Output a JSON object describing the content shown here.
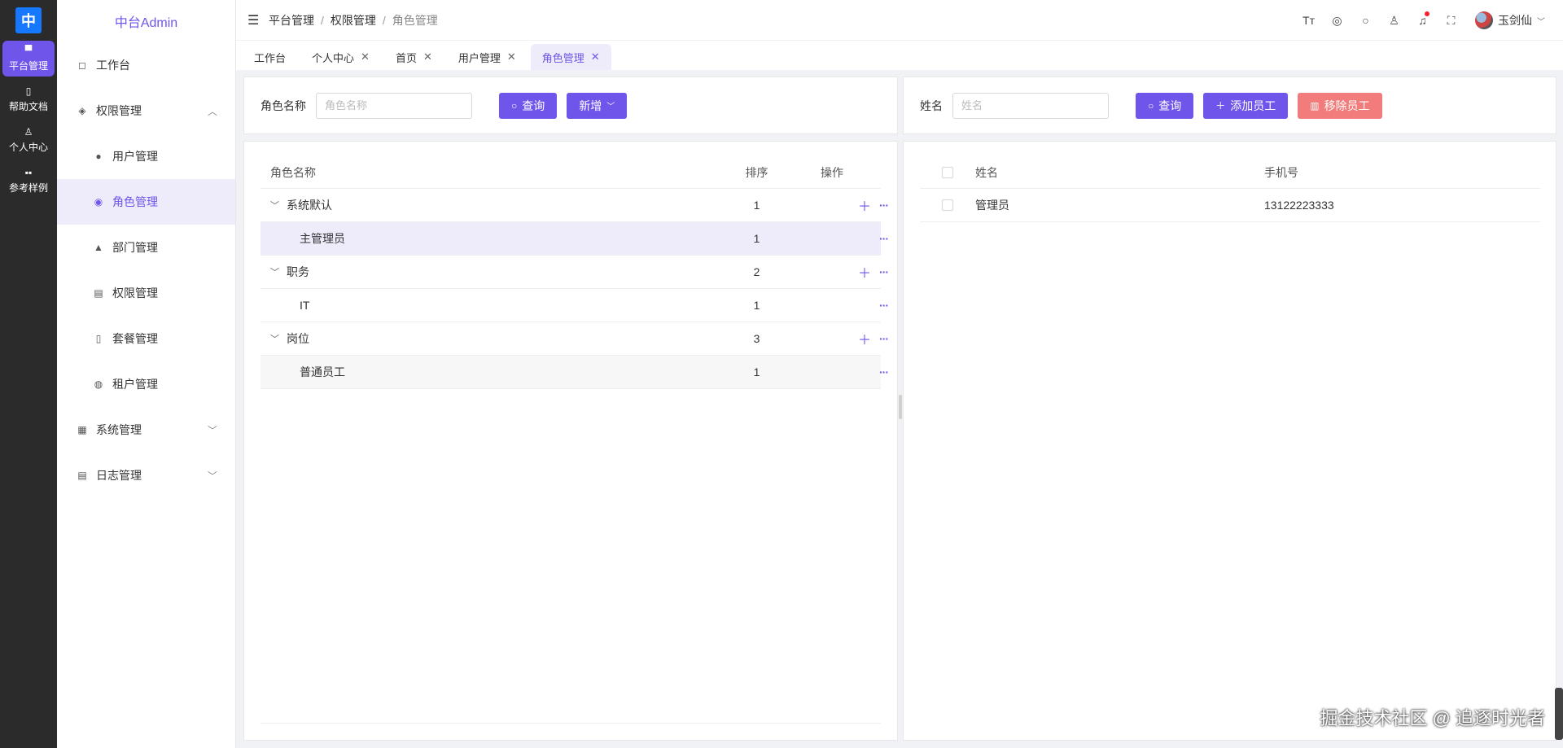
{
  "rail": {
    "logo": "中",
    "items": [
      {
        "label": "平台管理",
        "icon": "monitor-icon",
        "glyph": "▀"
      },
      {
        "label": "帮助文档",
        "icon": "document-icon",
        "glyph": "▯"
      },
      {
        "label": "个人中心",
        "icon": "user-icon",
        "glyph": "♙"
      },
      {
        "label": "参考样例",
        "icon": "grid-icon",
        "glyph": "▪▪"
      }
    ]
  },
  "menu": {
    "brand": "中台Admin",
    "items": [
      {
        "label": "工作台",
        "glyph": "◻"
      },
      {
        "label": "权限管理",
        "glyph": "◈"
      },
      {
        "label": "用户管理",
        "glyph": "●"
      },
      {
        "label": "角色管理",
        "glyph": "◉"
      },
      {
        "label": "部门管理",
        "glyph": "▲"
      },
      {
        "label": "权限管理",
        "glyph": "▤"
      },
      {
        "label": "套餐管理",
        "glyph": "▯"
      },
      {
        "label": "租户管理",
        "glyph": "◍"
      },
      {
        "label": "系统管理",
        "glyph": "▦"
      },
      {
        "label": "日志管理",
        "glyph": "▤"
      }
    ]
  },
  "header": {
    "breadcrumb": [
      "平台管理",
      "权限管理",
      "角色管理"
    ],
    "username": "玉剑仙"
  },
  "tabs": [
    "工作台",
    "个人中心",
    "首页",
    "用户管理",
    "角色管理"
  ],
  "role_search": {
    "label": "角色名称",
    "placeholder": "角色名称",
    "query_button": "查询",
    "add_button": "新增"
  },
  "user_search": {
    "label": "姓名",
    "placeholder": "姓名",
    "query_button": "查询",
    "add_button": "添加员工",
    "remove_button": "移除员工"
  },
  "role_table": {
    "columns": [
      "角色名称",
      "排序",
      "操作"
    ],
    "rows": [
      {
        "name": "系统默认",
        "sort": "1"
      },
      {
        "name": "主管理员",
        "sort": "1"
      },
      {
        "name": "职务",
        "sort": "2"
      },
      {
        "name": "IT",
        "sort": "1"
      },
      {
        "name": "岗位",
        "sort": "3"
      },
      {
        "name": "普通员工",
        "sort": "1"
      }
    ]
  },
  "user_table": {
    "columns": [
      "姓名",
      "手机号"
    ],
    "rows": [
      {
        "name": "管理员",
        "phone": "13122223333"
      }
    ]
  },
  "watermark": "掘金技术社区 @ 追逐时光者",
  "colors": {
    "accent": "#6f55ea",
    "danger": "#f27c7c",
    "rail": "#2b2b2b"
  }
}
